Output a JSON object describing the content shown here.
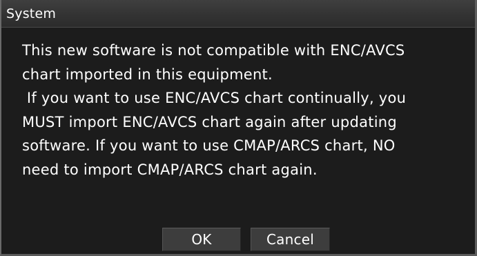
{
  "dialog": {
    "title": "System",
    "message_lines": [
      "This new software is not compatible with ENC/AVCS",
      "chart imported in this equipment.",
      " If you want to use ENC/AVCS chart continually, you",
      "MUST import ENC/AVCS chart again after updating",
      "software. If you want to use CMAP/ARCS chart, NO",
      "need to import CMAP/ARCS chart again."
    ],
    "buttons": {
      "ok_label": "OK",
      "cancel_label": "Cancel"
    }
  },
  "colors": {
    "background": "#1c1c1c",
    "titlebar": "#383838",
    "text": "#ffffff",
    "button": "#3d3d3d"
  }
}
